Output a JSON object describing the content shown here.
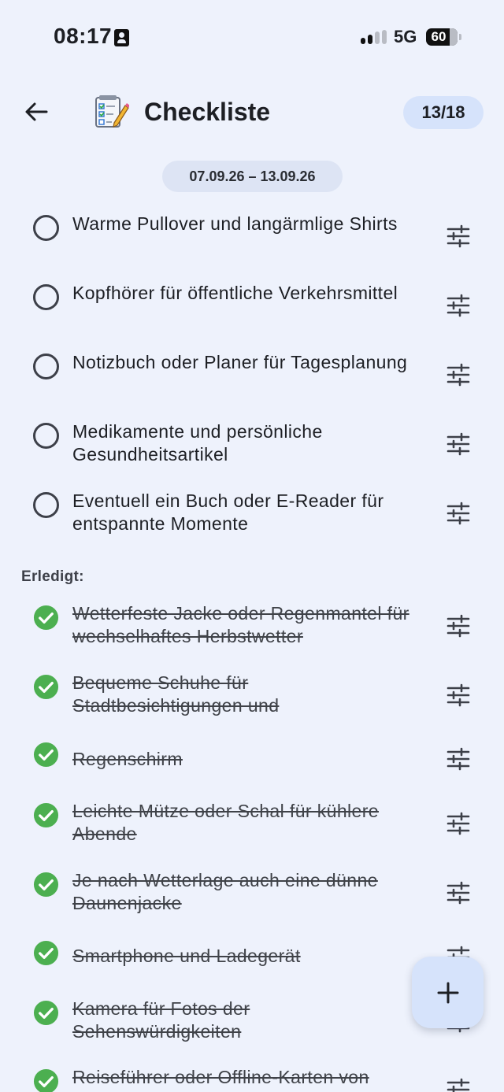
{
  "status_bar": {
    "time": "08:17",
    "network": "5G",
    "battery": "60"
  },
  "header": {
    "title": "Checkliste",
    "counter": "13/18"
  },
  "date_range": "07.09.26 – 13.09.26",
  "open_items": [
    {
      "text": "Warme Pullover und langärmlige Shirts"
    },
    {
      "text": "Kopfhörer für öffentliche Verkehrsmittel"
    },
    {
      "text": "Notizbuch oder Planer für Tagesplanung"
    },
    {
      "text": "Medikamente und persönliche Gesundheitsartikel"
    },
    {
      "text": "Eventuell ein Buch oder E-Reader für entspannte Momente"
    }
  ],
  "done_section_label": "Erledigt:",
  "done_items": [
    {
      "text": "Wetterfeste Jacke oder Regenmantel für wechselhaftes Herbstwetter"
    },
    {
      "text": "Bequeme Schuhe für Stadtbesichtigungen und"
    },
    {
      "text": "Regenschirm"
    },
    {
      "text": "Leichte Mütze oder Schal für kühlere Abende"
    },
    {
      "text": "Je nach Wetterlage auch eine dünne Daunenjacke"
    },
    {
      "text": "Smartphone und Ladegerät"
    },
    {
      "text": "Kamera für Fotos der Sehenswürdigkeiten"
    },
    {
      "text": "Reiseführer oder Offline-Karten von"
    }
  ],
  "colors": {
    "background": "#eef2fc",
    "accent": "#d6e3fb",
    "check": "#4caf50"
  },
  "icons": {
    "back": "arrow-left-icon",
    "tune": "tune-icon",
    "add": "plus-icon",
    "app": "checklist-notepad-icon"
  }
}
